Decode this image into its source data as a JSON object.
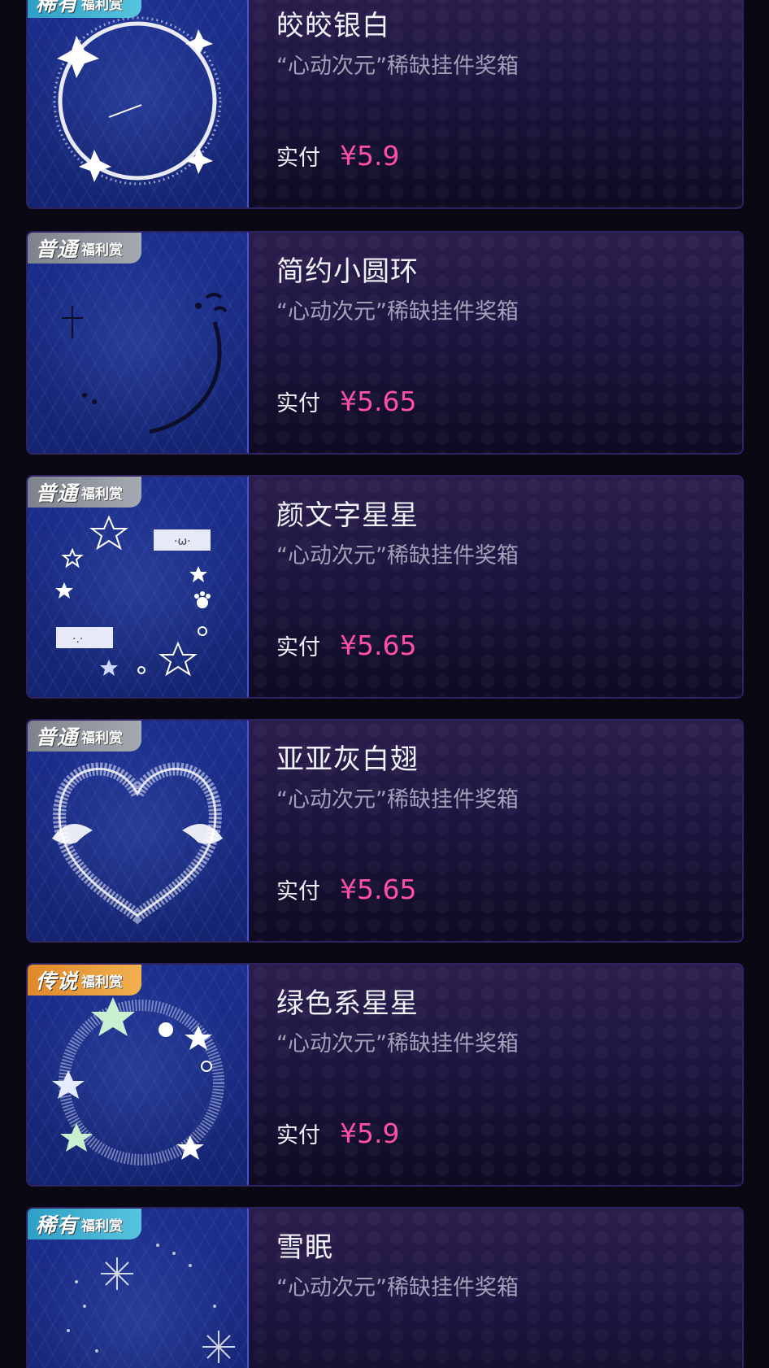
{
  "items": [
    {
      "badge": {
        "tier": "稀有",
        "sub": "福利赏",
        "color": "#2e9fc6"
      },
      "title": "皎皎银白",
      "desc": "“心动次元”稀缺挂件奖箱",
      "price_label": "实付",
      "price": "¥5.9",
      "icon": "silver-ring-icon"
    },
    {
      "badge": {
        "tier": "普通",
        "sub": "福利赏",
        "color": "#8a8f99"
      },
      "title": "简约小圆环",
      "desc": "“心动次元”稀缺挂件奖箱",
      "price_label": "实付",
      "price": "¥5.65",
      "icon": "simple-ring-icon"
    },
    {
      "badge": {
        "tier": "普通",
        "sub": "福利赏",
        "color": "#8a8f99"
      },
      "title": "颜文字星星",
      "desc": "“心动次元”稀缺挂件奖箱",
      "price_label": "实付",
      "price": "¥5.65",
      "icon": "emoticon-stars-icon"
    },
    {
      "badge": {
        "tier": "普通",
        "sub": "福利赏",
        "color": "#8a8f99"
      },
      "title": "亚亚灰白翅",
      "desc": "“心动次元”稀缺挂件奖箱",
      "price_label": "实付",
      "price": "¥5.65",
      "icon": "winged-heart-icon"
    },
    {
      "badge": {
        "tier": "传说",
        "sub": "福利赏",
        "color": "#e8962f"
      },
      "title": "绿色系星星",
      "desc": "“心动次元”稀缺挂件奖箱",
      "price_label": "实付",
      "price": "¥5.9",
      "icon": "green-stars-ring-icon"
    },
    {
      "badge": {
        "tier": "稀有",
        "sub": "福利赏",
        "color": "#2e9fc6"
      },
      "title": "雪眠",
      "desc": "“心动次元”稀缺挂件奖箱",
      "price_label": "",
      "price": "",
      "icon": "snowflake-ring-icon"
    }
  ]
}
